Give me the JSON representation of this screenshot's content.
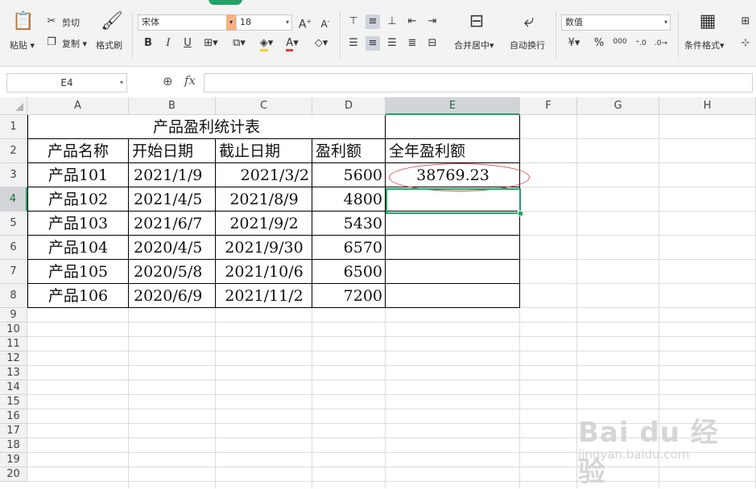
{
  "ribbon": {
    "paste_label": "粘贴",
    "cut_label": "剪切",
    "copy_label": "复制",
    "format_painter_label": "格式刷",
    "font_name": "宋体",
    "font_size": "18",
    "bold_glyph": "B",
    "italic_glyph": "I",
    "underline_glyph": "U",
    "merge_center_label": "合并居中",
    "wrap_text_label": "自动换行",
    "number_format": "数值",
    "currency_glyph": "¥",
    "percent_glyph": "%",
    "thousands_glyph": "000",
    "conditional_format_label": "条件格式",
    "accent_color": "#21a366",
    "font_color": "#e03b3b",
    "fill_color": "#f5d22e"
  },
  "formula_bar": {
    "cell_ref": "E4",
    "fx_label": "fx",
    "formula": ""
  },
  "grid": {
    "columns": [
      "A",
      "B",
      "C",
      "D",
      "E",
      "F",
      "G",
      "H"
    ],
    "active_column": "E",
    "rows": [
      "1",
      "2",
      "3",
      "4",
      "5",
      "6",
      "7",
      "8",
      "9",
      "10",
      "11",
      "12",
      "13",
      "14",
      "15",
      "16",
      "17",
      "18",
      "19",
      "20"
    ],
    "active_row": "4"
  },
  "sheet": {
    "title": "产品盈利统计表",
    "headers": [
      "产品名称",
      "开始日期",
      "截止日期",
      "盈利额",
      "全年盈利额"
    ],
    "rows": [
      [
        "产品101",
        "2021/1/9",
        "2021/3/2",
        "5600",
        "38769.23"
      ],
      [
        "产品102",
        "2021/4/5",
        "2021/8/9",
        "4800",
        ""
      ],
      [
        "产品103",
        "2021/6/7",
        "2021/9/2",
        "5430",
        ""
      ],
      [
        "产品104",
        "2020/4/5",
        "2021/9/30",
        "6570",
        ""
      ],
      [
        "产品105",
        "2020/5/8",
        "2021/10/6",
        "6500",
        ""
      ],
      [
        "产品106",
        "2020/6/9",
        "2021/11/2",
        "7200",
        ""
      ]
    ],
    "selected_cell": "E4",
    "highlight_color": "#e0484a"
  },
  "watermark": {
    "line1": "Bai du 经验",
    "line2": "jingyan.baidu.com"
  }
}
